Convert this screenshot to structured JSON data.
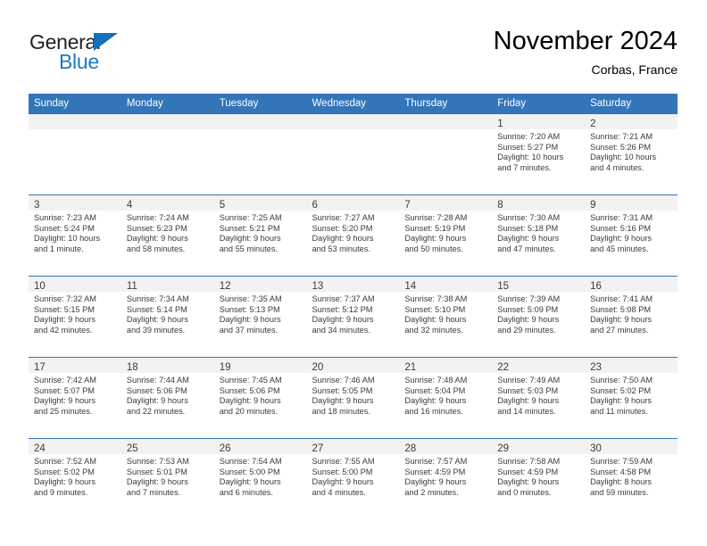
{
  "brand": {
    "name_part1": "General",
    "name_part2": "Blue",
    "color_dark": "#231f20",
    "color_blue": "#1a7ac4"
  },
  "header": {
    "title": "November 2024",
    "subtitle": "Corbas, France",
    "accent_color": "#3275b9",
    "band_color": "#f2f2f2"
  },
  "weekdays": [
    "Sunday",
    "Monday",
    "Tuesday",
    "Wednesday",
    "Thursday",
    "Friday",
    "Saturday"
  ],
  "weeks": [
    [
      {
        "day": "",
        "sunrise": "",
        "sunset": "",
        "daylight1": "",
        "daylight2": "",
        "empty": true
      },
      {
        "day": "",
        "sunrise": "",
        "sunset": "",
        "daylight1": "",
        "daylight2": "",
        "empty": true
      },
      {
        "day": "",
        "sunrise": "",
        "sunset": "",
        "daylight1": "",
        "daylight2": "",
        "empty": true
      },
      {
        "day": "",
        "sunrise": "",
        "sunset": "",
        "daylight1": "",
        "daylight2": "",
        "empty": true
      },
      {
        "day": "",
        "sunrise": "",
        "sunset": "",
        "daylight1": "",
        "daylight2": "",
        "empty": true
      },
      {
        "day": "1",
        "sunrise": "Sunrise: 7:20 AM",
        "sunset": "Sunset: 5:27 PM",
        "daylight1": "Daylight: 10 hours",
        "daylight2": "and 7 minutes.",
        "empty": false
      },
      {
        "day": "2",
        "sunrise": "Sunrise: 7:21 AM",
        "sunset": "Sunset: 5:26 PM",
        "daylight1": "Daylight: 10 hours",
        "daylight2": "and 4 minutes.",
        "empty": false
      }
    ],
    [
      {
        "day": "3",
        "sunrise": "Sunrise: 7:23 AM",
        "sunset": "Sunset: 5:24 PM",
        "daylight1": "Daylight: 10 hours",
        "daylight2": "and 1 minute.",
        "empty": false
      },
      {
        "day": "4",
        "sunrise": "Sunrise: 7:24 AM",
        "sunset": "Sunset: 5:23 PM",
        "daylight1": "Daylight: 9 hours",
        "daylight2": "and 58 minutes.",
        "empty": false
      },
      {
        "day": "5",
        "sunrise": "Sunrise: 7:25 AM",
        "sunset": "Sunset: 5:21 PM",
        "daylight1": "Daylight: 9 hours",
        "daylight2": "and 55 minutes.",
        "empty": false
      },
      {
        "day": "6",
        "sunrise": "Sunrise: 7:27 AM",
        "sunset": "Sunset: 5:20 PM",
        "daylight1": "Daylight: 9 hours",
        "daylight2": "and 53 minutes.",
        "empty": false
      },
      {
        "day": "7",
        "sunrise": "Sunrise: 7:28 AM",
        "sunset": "Sunset: 5:19 PM",
        "daylight1": "Daylight: 9 hours",
        "daylight2": "and 50 minutes.",
        "empty": false
      },
      {
        "day": "8",
        "sunrise": "Sunrise: 7:30 AM",
        "sunset": "Sunset: 5:18 PM",
        "daylight1": "Daylight: 9 hours",
        "daylight2": "and 47 minutes.",
        "empty": false
      },
      {
        "day": "9",
        "sunrise": "Sunrise: 7:31 AM",
        "sunset": "Sunset: 5:16 PM",
        "daylight1": "Daylight: 9 hours",
        "daylight2": "and 45 minutes.",
        "empty": false
      }
    ],
    [
      {
        "day": "10",
        "sunrise": "Sunrise: 7:32 AM",
        "sunset": "Sunset: 5:15 PM",
        "daylight1": "Daylight: 9 hours",
        "daylight2": "and 42 minutes.",
        "empty": false
      },
      {
        "day": "11",
        "sunrise": "Sunrise: 7:34 AM",
        "sunset": "Sunset: 5:14 PM",
        "daylight1": "Daylight: 9 hours",
        "daylight2": "and 39 minutes.",
        "empty": false
      },
      {
        "day": "12",
        "sunrise": "Sunrise: 7:35 AM",
        "sunset": "Sunset: 5:13 PM",
        "daylight1": "Daylight: 9 hours",
        "daylight2": "and 37 minutes.",
        "empty": false
      },
      {
        "day": "13",
        "sunrise": "Sunrise: 7:37 AM",
        "sunset": "Sunset: 5:12 PM",
        "daylight1": "Daylight: 9 hours",
        "daylight2": "and 34 minutes.",
        "empty": false
      },
      {
        "day": "14",
        "sunrise": "Sunrise: 7:38 AM",
        "sunset": "Sunset: 5:10 PM",
        "daylight1": "Daylight: 9 hours",
        "daylight2": "and 32 minutes.",
        "empty": false
      },
      {
        "day": "15",
        "sunrise": "Sunrise: 7:39 AM",
        "sunset": "Sunset: 5:09 PM",
        "daylight1": "Daylight: 9 hours",
        "daylight2": "and 29 minutes.",
        "empty": false
      },
      {
        "day": "16",
        "sunrise": "Sunrise: 7:41 AM",
        "sunset": "Sunset: 5:08 PM",
        "daylight1": "Daylight: 9 hours",
        "daylight2": "and 27 minutes.",
        "empty": false
      }
    ],
    [
      {
        "day": "17",
        "sunrise": "Sunrise: 7:42 AM",
        "sunset": "Sunset: 5:07 PM",
        "daylight1": "Daylight: 9 hours",
        "daylight2": "and 25 minutes.",
        "empty": false
      },
      {
        "day": "18",
        "sunrise": "Sunrise: 7:44 AM",
        "sunset": "Sunset: 5:06 PM",
        "daylight1": "Daylight: 9 hours",
        "daylight2": "and 22 minutes.",
        "empty": false
      },
      {
        "day": "19",
        "sunrise": "Sunrise: 7:45 AM",
        "sunset": "Sunset: 5:06 PM",
        "daylight1": "Daylight: 9 hours",
        "daylight2": "and 20 minutes.",
        "empty": false
      },
      {
        "day": "20",
        "sunrise": "Sunrise: 7:46 AM",
        "sunset": "Sunset: 5:05 PM",
        "daylight1": "Daylight: 9 hours",
        "daylight2": "and 18 minutes.",
        "empty": false
      },
      {
        "day": "21",
        "sunrise": "Sunrise: 7:48 AM",
        "sunset": "Sunset: 5:04 PM",
        "daylight1": "Daylight: 9 hours",
        "daylight2": "and 16 minutes.",
        "empty": false
      },
      {
        "day": "22",
        "sunrise": "Sunrise: 7:49 AM",
        "sunset": "Sunset: 5:03 PM",
        "daylight1": "Daylight: 9 hours",
        "daylight2": "and 14 minutes.",
        "empty": false
      },
      {
        "day": "23",
        "sunrise": "Sunrise: 7:50 AM",
        "sunset": "Sunset: 5:02 PM",
        "daylight1": "Daylight: 9 hours",
        "daylight2": "and 11 minutes.",
        "empty": false
      }
    ],
    [
      {
        "day": "24",
        "sunrise": "Sunrise: 7:52 AM",
        "sunset": "Sunset: 5:02 PM",
        "daylight1": "Daylight: 9 hours",
        "daylight2": "and 9 minutes.",
        "empty": false
      },
      {
        "day": "25",
        "sunrise": "Sunrise: 7:53 AM",
        "sunset": "Sunset: 5:01 PM",
        "daylight1": "Daylight: 9 hours",
        "daylight2": "and 7 minutes.",
        "empty": false
      },
      {
        "day": "26",
        "sunrise": "Sunrise: 7:54 AM",
        "sunset": "Sunset: 5:00 PM",
        "daylight1": "Daylight: 9 hours",
        "daylight2": "and 6 minutes.",
        "empty": false
      },
      {
        "day": "27",
        "sunrise": "Sunrise: 7:55 AM",
        "sunset": "Sunset: 5:00 PM",
        "daylight1": "Daylight: 9 hours",
        "daylight2": "and 4 minutes.",
        "empty": false
      },
      {
        "day": "28",
        "sunrise": "Sunrise: 7:57 AM",
        "sunset": "Sunset: 4:59 PM",
        "daylight1": "Daylight: 9 hours",
        "daylight2": "and 2 minutes.",
        "empty": false
      },
      {
        "day": "29",
        "sunrise": "Sunrise: 7:58 AM",
        "sunset": "Sunset: 4:59 PM",
        "daylight1": "Daylight: 9 hours",
        "daylight2": "and 0 minutes.",
        "empty": false
      },
      {
        "day": "30",
        "sunrise": "Sunrise: 7:59 AM",
        "sunset": "Sunset: 4:58 PM",
        "daylight1": "Daylight: 8 hours",
        "daylight2": "and 59 minutes.",
        "empty": false
      }
    ]
  ]
}
